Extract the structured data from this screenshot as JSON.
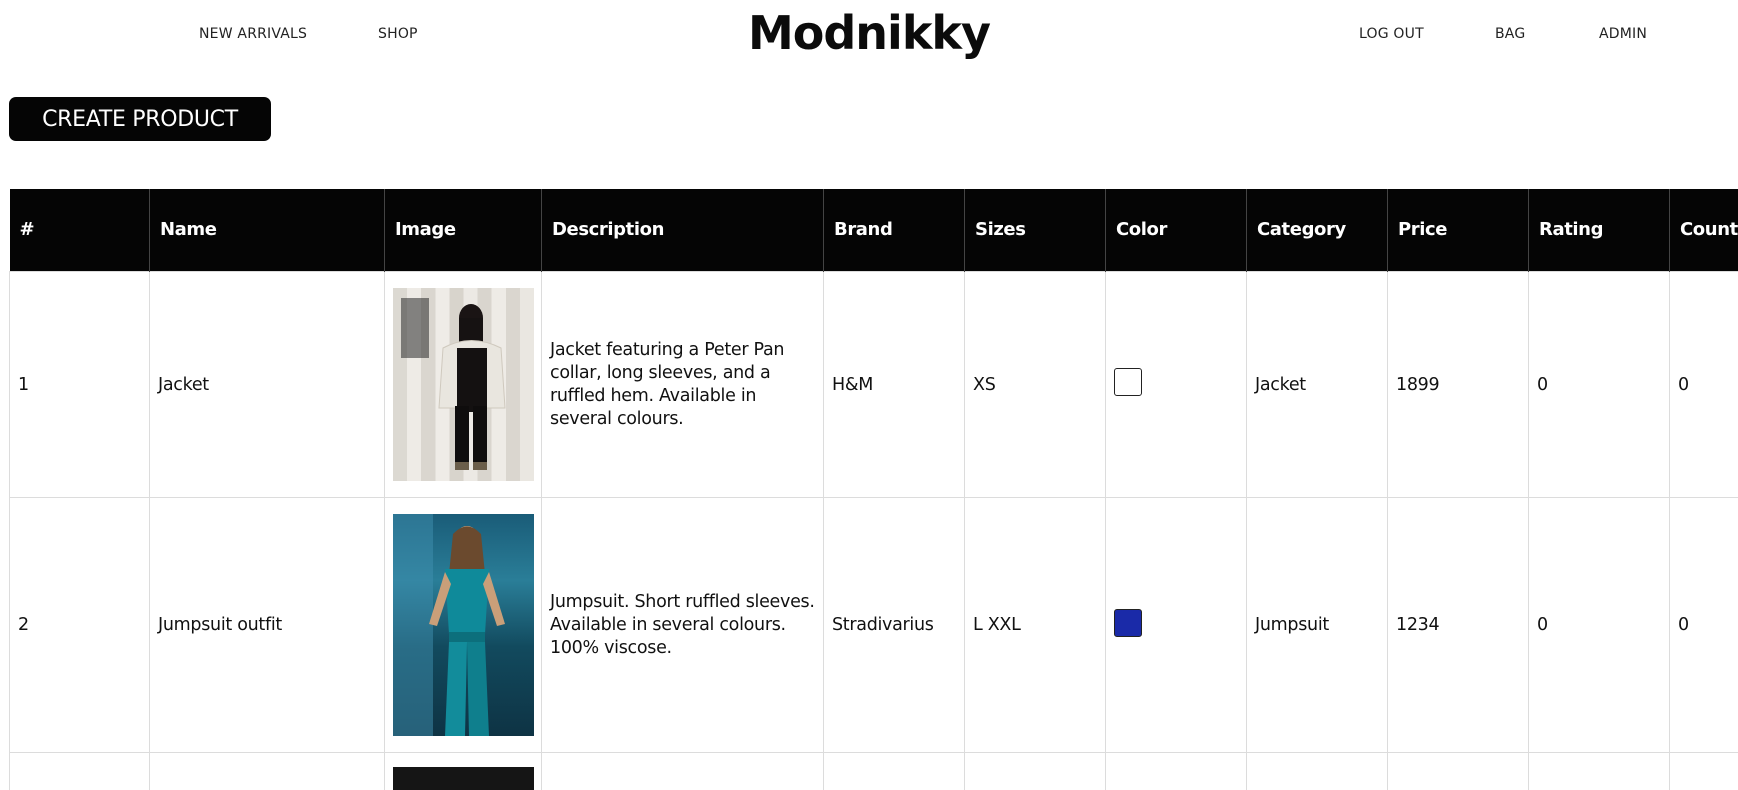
{
  "nav": {
    "left": [
      "NEW ARRIVALS",
      "SHOP"
    ],
    "logo": "Modnikky",
    "right": [
      "LOG OUT",
      "BAG",
      "ADMIN"
    ]
  },
  "actions": {
    "create_label": "CREATE PRODUCT"
  },
  "table": {
    "headers": [
      "#",
      "Name",
      "Image",
      "Description",
      "Brand",
      "Sizes",
      "Color",
      "Category",
      "Price",
      "Rating",
      "Count Review"
    ],
    "rows": [
      {
        "num": "1",
        "name": "Jacket",
        "image": "jacket-model-photo",
        "description": "Jacket featuring a Peter Pan collar, long sleeves, and a ruffled hem. Available in several colours.",
        "brand": "H&M",
        "sizes": "XS",
        "color": "#ffffff",
        "category": "Jacket",
        "price": "1899",
        "rating": "0",
        "count_review": "0"
      },
      {
        "num": "2",
        "name": "Jumpsuit outfit",
        "image": "jumpsuit-model-photo",
        "description": "Jumpsuit. Short ruffled sleeves. Available in several colours. 100% viscose.",
        "brand": "Stradivarius",
        "sizes": "L XXL",
        "color": "#1a2aa8",
        "category": "Jumpsuit",
        "price": "1234",
        "rating": "0",
        "count_review": "0"
      }
    ]
  }
}
